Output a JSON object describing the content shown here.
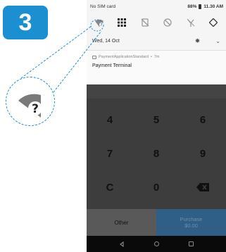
{
  "step_number": "3",
  "status_bar": {
    "carrier": "No SIM card",
    "battery": "88%",
    "time": "11.30 AM"
  },
  "quick_settings": {
    "icons": [
      "wifi-question-icon",
      "grid-icon",
      "no-notifications-icon",
      "dnd-icon",
      "no-data-icon",
      "rotate-icon"
    ]
  },
  "date_row": {
    "date": "Wed, 14 Oct"
  },
  "notification": {
    "app": "PaymentApplicationStandard",
    "age": "7m",
    "title": "Payment Terminal"
  },
  "keypad": {
    "keys": [
      "4",
      "5",
      "6",
      "7",
      "8",
      "9",
      "C",
      "0"
    ]
  },
  "buttons": {
    "other": "Other",
    "purchase": "Purchase",
    "amount": "$0.00"
  },
  "colors": {
    "accent": "#1b8fd0",
    "purchase_bg": "#2f5f86"
  }
}
